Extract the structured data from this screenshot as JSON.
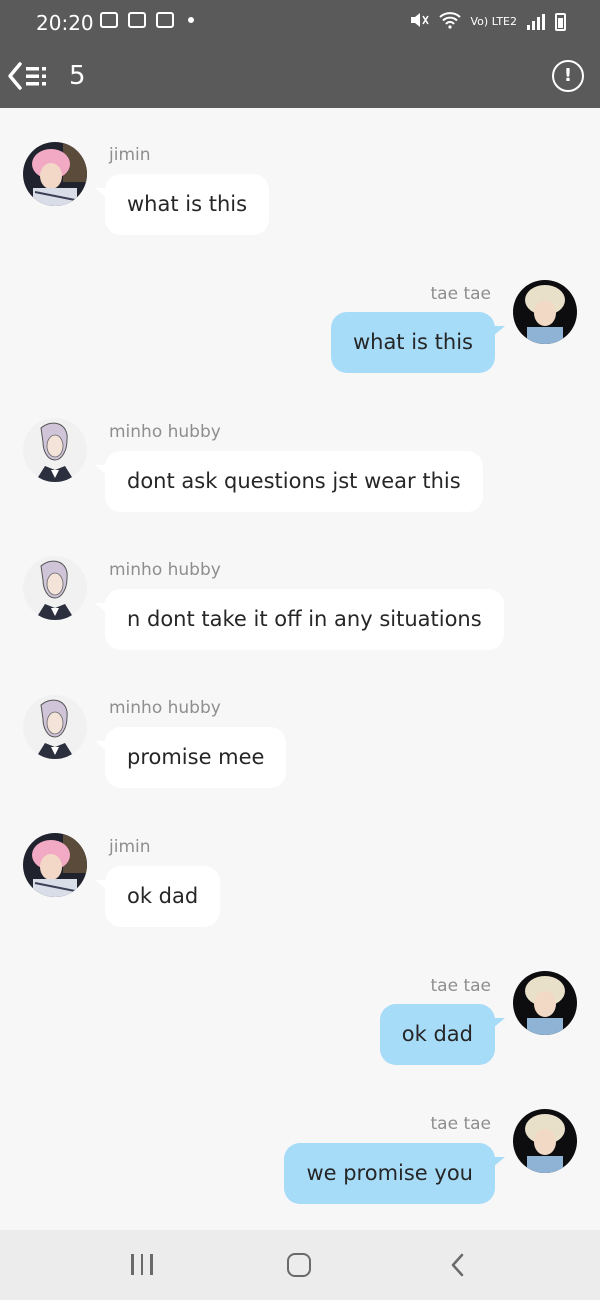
{
  "status": {
    "time": "20:20",
    "network": "Vo) LTE2"
  },
  "header": {
    "member_count": "5"
  },
  "colors": {
    "header_bg": "#5a5a5a",
    "incoming_bubble": "#ffffff",
    "outgoing_bubble": "#a7dcf9",
    "background": "#f7f7f7"
  },
  "messages": [
    {
      "sender": "jimin",
      "text": "what is this",
      "side": "left",
      "avatar": "pink-hair-photo"
    },
    {
      "sender": "tae tae",
      "text": "what is this",
      "side": "right",
      "avatar": "blond-hair-photo"
    },
    {
      "sender": "minho hubby",
      "text": "dont ask questions jst wear this",
      "side": "left",
      "avatar": "anime-sketch"
    },
    {
      "sender": "minho hubby",
      "text": "n dont take it off in any situations",
      "side": "left",
      "avatar": "anime-sketch"
    },
    {
      "sender": "minho hubby",
      "text": "promise mee",
      "side": "left",
      "avatar": "anime-sketch"
    },
    {
      "sender": "jimin",
      "text": "ok dad",
      "side": "left",
      "avatar": "pink-hair-photo"
    },
    {
      "sender": "tae tae",
      "text": "ok dad",
      "side": "right",
      "avatar": "blond-hair-photo"
    },
    {
      "sender": "tae tae",
      "text": "we promise you",
      "side": "right",
      "avatar": "blond-hair-photo"
    }
  ]
}
